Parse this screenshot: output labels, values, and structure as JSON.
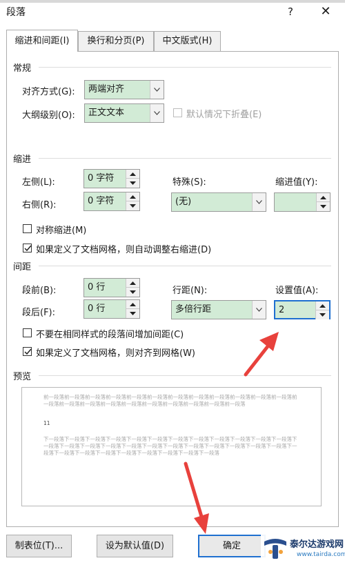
{
  "dialog": {
    "title": "段落",
    "help": "?",
    "close": "✕"
  },
  "tabs": [
    {
      "label": "缩进和间距(I)",
      "active": true
    },
    {
      "label": "换行和分页(P)",
      "active": false
    },
    {
      "label": "中文版式(H)",
      "active": false
    }
  ],
  "general": {
    "heading": "常规",
    "alignment_label": "对齐方式(G):",
    "alignment_value": "两端对齐",
    "outline_label": "大纲级别(O):",
    "outline_value": "正文文本",
    "collapse_label": "默认情况下折叠(E)",
    "collapse_checked": false
  },
  "indent": {
    "heading": "缩进",
    "left_label": "左侧(L):",
    "left_value": "0 字符",
    "right_label": "右侧(R):",
    "right_value": "0 字符",
    "special_label": "特殊(S):",
    "special_value": "(无)",
    "by_label": "缩进值(Y):",
    "by_value": "",
    "mirror_label": "对称缩进(M)",
    "mirror_checked": false,
    "auto_adjust_label": "如果定义了文档网格，则自动调整右缩进(D)",
    "auto_adjust_checked": true
  },
  "spacing": {
    "heading": "间距",
    "before_label": "段前(B):",
    "before_value": "0 行",
    "after_label": "段后(F):",
    "after_value": "0 行",
    "line_label": "行距(N):",
    "line_value": "多倍行距",
    "at_label": "设置值(A):",
    "at_value": "2",
    "no_space_label": "不要在相同样式的段落间增加间距(C)",
    "no_space_checked": false,
    "snap_label": "如果定义了文档网格，则对齐到网格(W)",
    "snap_checked": true
  },
  "preview": {
    "heading": "预览",
    "before_text": "前一段落前一段落前一段落前一段落前一段落前一段落前一段落前一段落前一段落前一段落前一段落前一段落前一段落前一段落前一段落前一段落前一段落前一段落前一段落前一段落前一段落前一段落",
    "main_text": "11",
    "after_text": "下一段落下一段落下一段落下一段落下一段落下一段落下一段落下一段落下一段落下一段落下一段落下一段落下一段落下一段落下一段落下一段落下一段落下一段落下一段落下一段落下一段落下一段落下一段落下一段落下一段落下一段落下一段落下一段落下一段落下一段落下一段落下一段落下一段落"
  },
  "buttons": {
    "tabs": "制表位(T)...",
    "set_default": "设为默认值(D)",
    "ok": "确定"
  },
  "watermark": {
    "title": "泰尔达游戏网",
    "url": "www.tairda.com"
  },
  "colors": {
    "field_bg": "#d2ebd6",
    "focus": "#1e6fd0",
    "annotation": "#e8413c"
  }
}
